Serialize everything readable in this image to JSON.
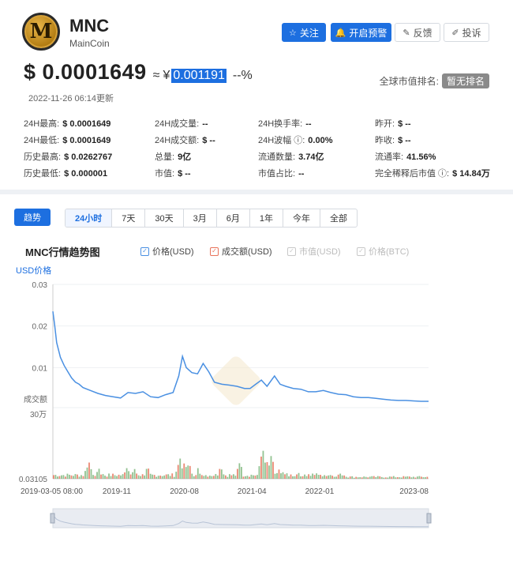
{
  "coin": {
    "symbol": "MNC",
    "name": "MainCoin",
    "logo_letter": "M"
  },
  "actions": {
    "follow": "关注",
    "alert": "开启预警",
    "feedback": "反馈",
    "complain": "投诉"
  },
  "price": {
    "usd": "$ 0.0001649",
    "approx": "≈",
    "cny_symbol": "¥",
    "cny": "0.001191",
    "change": "--%",
    "updated": "2022-11-26 06:14更新"
  },
  "rank": {
    "label": "全球市值排名:",
    "value": "暂无排名"
  },
  "stats": [
    {
      "label": "24H最高:",
      "value": "$ 0.0001649"
    },
    {
      "label": "24H成交量:",
      "value": "--"
    },
    {
      "label": "24H换手率:",
      "value": "--"
    },
    {
      "label": "昨开:",
      "value": "$ --"
    },
    {
      "label": "24H最低:",
      "value": "$ 0.0001649"
    },
    {
      "label": "24H成交额:",
      "value": "$ --"
    },
    {
      "label": "24H波幅 ⓘ:",
      "value": "0.00%"
    },
    {
      "label": "昨收:",
      "value": "$ --"
    },
    {
      "label": "历史最高:",
      "value": "$ 0.0262767"
    },
    {
      "label": "总量:",
      "value": "9亿"
    },
    {
      "label": "流通数量:",
      "value": "3.74亿"
    },
    {
      "label": "流通率:",
      "value": "41.56%"
    },
    {
      "label": "历史最低:",
      "value": "$ 0.000001"
    },
    {
      "label": "市值:",
      "value": "$ --"
    },
    {
      "label": "市值占比:",
      "value": "--"
    },
    {
      "label": "完全稀释后市值 ⓘ:",
      "value": "$ 14.84万"
    }
  ],
  "tabs": {
    "trend": "趋势",
    "ranges": [
      "24小时",
      "7天",
      "30天",
      "3月",
      "6月",
      "1年",
      "今年",
      "全部"
    ],
    "active_range": 0
  },
  "chart_title": "MNC行情趋势图",
  "legend": [
    {
      "label": "价格(USD)",
      "checked": true,
      "color": "#4a90e2"
    },
    {
      "label": "成交额(USD)",
      "checked": true,
      "color": "#e8735a"
    },
    {
      "label": "市值(USD)",
      "checked": false,
      "color": "#c8c8c8"
    },
    {
      "label": "价格(BTC)",
      "checked": false,
      "color": "#c8c8c8"
    }
  ],
  "colors": {
    "accent": "#1d6fe0",
    "price_line": "#4a90e2",
    "volume_green": "#7fb77e",
    "volume_red": "#e8735a"
  },
  "chart_data": {
    "type": "line",
    "ylabel": "USD价格",
    "volume_label": "成交额",
    "volume_max_label": "30万",
    "y_ticks": [
      "0.03",
      "0.02",
      "0.01"
    ],
    "y_min_label": "0.03105",
    "ylim": [
      0,
      0.03
    ],
    "x_tick_labels": [
      "2019-03-05 08:00",
      "2019-11",
      "2020-08",
      "2021-04",
      "2022-01",
      "2023-08"
    ],
    "x_tick_positions": [
      0,
      0.17,
      0.35,
      0.53,
      0.71,
      1.0
    ],
    "series": [
      {
        "name": "价格(USD)",
        "points": [
          [
            0.0,
            0.0235
          ],
          [
            0.005,
            0.02
          ],
          [
            0.01,
            0.016
          ],
          [
            0.02,
            0.0125
          ],
          [
            0.03,
            0.0105
          ],
          [
            0.04,
            0.009
          ],
          [
            0.05,
            0.0075
          ],
          [
            0.06,
            0.0065
          ],
          [
            0.07,
            0.006
          ],
          [
            0.08,
            0.0052
          ],
          [
            0.1,
            0.0045
          ],
          [
            0.12,
            0.0038
          ],
          [
            0.14,
            0.0033
          ],
          [
            0.16,
            0.003
          ],
          [
            0.18,
            0.0027
          ],
          [
            0.2,
            0.004
          ],
          [
            0.22,
            0.0038
          ],
          [
            0.24,
            0.0042
          ],
          [
            0.26,
            0.003
          ],
          [
            0.28,
            0.0028
          ],
          [
            0.3,
            0.0035
          ],
          [
            0.32,
            0.004
          ],
          [
            0.335,
            0.008
          ],
          [
            0.345,
            0.0127
          ],
          [
            0.355,
            0.01
          ],
          [
            0.37,
            0.0088
          ],
          [
            0.385,
            0.0085
          ],
          [
            0.4,
            0.011
          ],
          [
            0.415,
            0.009
          ],
          [
            0.43,
            0.0065
          ],
          [
            0.45,
            0.006
          ],
          [
            0.47,
            0.0058
          ],
          [
            0.49,
            0.0055
          ],
          [
            0.51,
            0.005
          ],
          [
            0.525,
            0.005
          ],
          [
            0.54,
            0.006
          ],
          [
            0.555,
            0.007
          ],
          [
            0.57,
            0.0055
          ],
          [
            0.59,
            0.008
          ],
          [
            0.605,
            0.006
          ],
          [
            0.62,
            0.0055
          ],
          [
            0.64,
            0.005
          ],
          [
            0.66,
            0.0048
          ],
          [
            0.68,
            0.0042
          ],
          [
            0.7,
            0.0042
          ],
          [
            0.72,
            0.0045
          ],
          [
            0.74,
            0.004
          ],
          [
            0.76,
            0.0036
          ],
          [
            0.78,
            0.0035
          ],
          [
            0.8,
            0.003
          ],
          [
            0.82,
            0.0028
          ],
          [
            0.84,
            0.0028
          ],
          [
            0.86,
            0.0026
          ],
          [
            0.88,
            0.0024
          ],
          [
            0.9,
            0.0022
          ],
          [
            0.92,
            0.0021
          ],
          [
            0.94,
            0.0021
          ],
          [
            0.96,
            0.002
          ],
          [
            0.98,
            0.0019
          ],
          [
            1.0,
            0.0019
          ]
        ]
      },
      {
        "name": "成交额(USD)",
        "peaks": [
          [
            0.09,
            0.3
          ],
          [
            0.095,
            0.35
          ],
          [
            0.12,
            0.22
          ],
          [
            0.195,
            0.28
          ],
          [
            0.215,
            0.22
          ],
          [
            0.25,
            0.22
          ],
          [
            0.335,
            0.5
          ],
          [
            0.35,
            0.35
          ],
          [
            0.36,
            0.3
          ],
          [
            0.385,
            0.2
          ],
          [
            0.445,
            0.25
          ],
          [
            0.495,
            0.35
          ],
          [
            0.555,
            0.7
          ],
          [
            0.565,
            0.4
          ],
          [
            0.58,
            0.5
          ],
          [
            0.6,
            0.2
          ],
          [
            0.61,
            0.18
          ],
          [
            0.65,
            0.15
          ],
          [
            0.7,
            0.12
          ],
          [
            0.76,
            0.1
          ]
        ]
      }
    ]
  }
}
